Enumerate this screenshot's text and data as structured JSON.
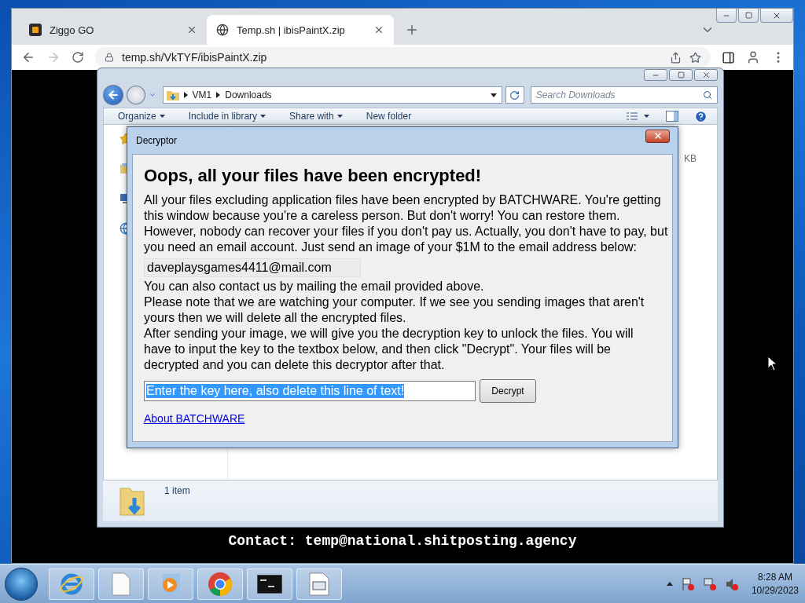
{
  "browser": {
    "tabs": [
      {
        "label": "Ziggo GO",
        "kind": "ziggo",
        "selected": false
      },
      {
        "label": "Temp.sh | ibisPaintX.zip",
        "kind": "globe",
        "selected": true
      }
    ],
    "address": "temp.sh/VkTYF/ibisPaintX.zip",
    "caption": {
      "label": "Contact:",
      "value": "temp@national.shitposting.agency"
    }
  },
  "explorer": {
    "breadcrumb": [
      "VM1",
      "Downloads"
    ],
    "search": {
      "placeholder": "Search Downloads"
    },
    "commands": [
      {
        "label": "Organize",
        "has_menu": true
      },
      {
        "label": "Include in library",
        "has_menu": true
      },
      {
        "label": "Share with",
        "has_menu": true
      },
      {
        "label": "New folder",
        "has_menu": false
      }
    ],
    "size_fragment": "KB",
    "status": "1 item"
  },
  "dialog": {
    "title": "Decryptor",
    "heading": "Oops, all your files have been encrypted!",
    "paragraph": "All your files excluding application files have been encrypted by BATCHWARE. You're getting this window because you're a careless person. But don't worry! You can restore them. However, nobody can recover your files if you don't pay us. Actually, you don't have to pay, but you need an email account. Just send an image of your $1M to the email address below:",
    "email": "daveplaysgames4411@mail.com",
    "notes": [
      "You can also contact us by mailing the email provided above.",
      "Please note that we are watching your computer. If we see you sending images that aren't yours then we will delete all the encrypted files.",
      "After sending your image, we will give you the decryption key to unlock the files. You will have to input the key to the textbox below, and then click \"Decrypt\". Your files will be decrypted and you can delete this decryptor after that."
    ],
    "key_field": {
      "value": "Enter the key here, also delete this line of text!",
      "text_selected": true
    },
    "button": "Decrypt",
    "link": "About BATCHWARE"
  },
  "taskbar": {
    "apps": [
      {
        "kind": "ie"
      },
      {
        "kind": "file"
      },
      {
        "kind": "media"
      },
      {
        "kind": "chrome"
      },
      {
        "kind": "cmd"
      },
      {
        "kind": "app"
      }
    ],
    "time": "8:28 AM",
    "date": "10/29/2023"
  }
}
